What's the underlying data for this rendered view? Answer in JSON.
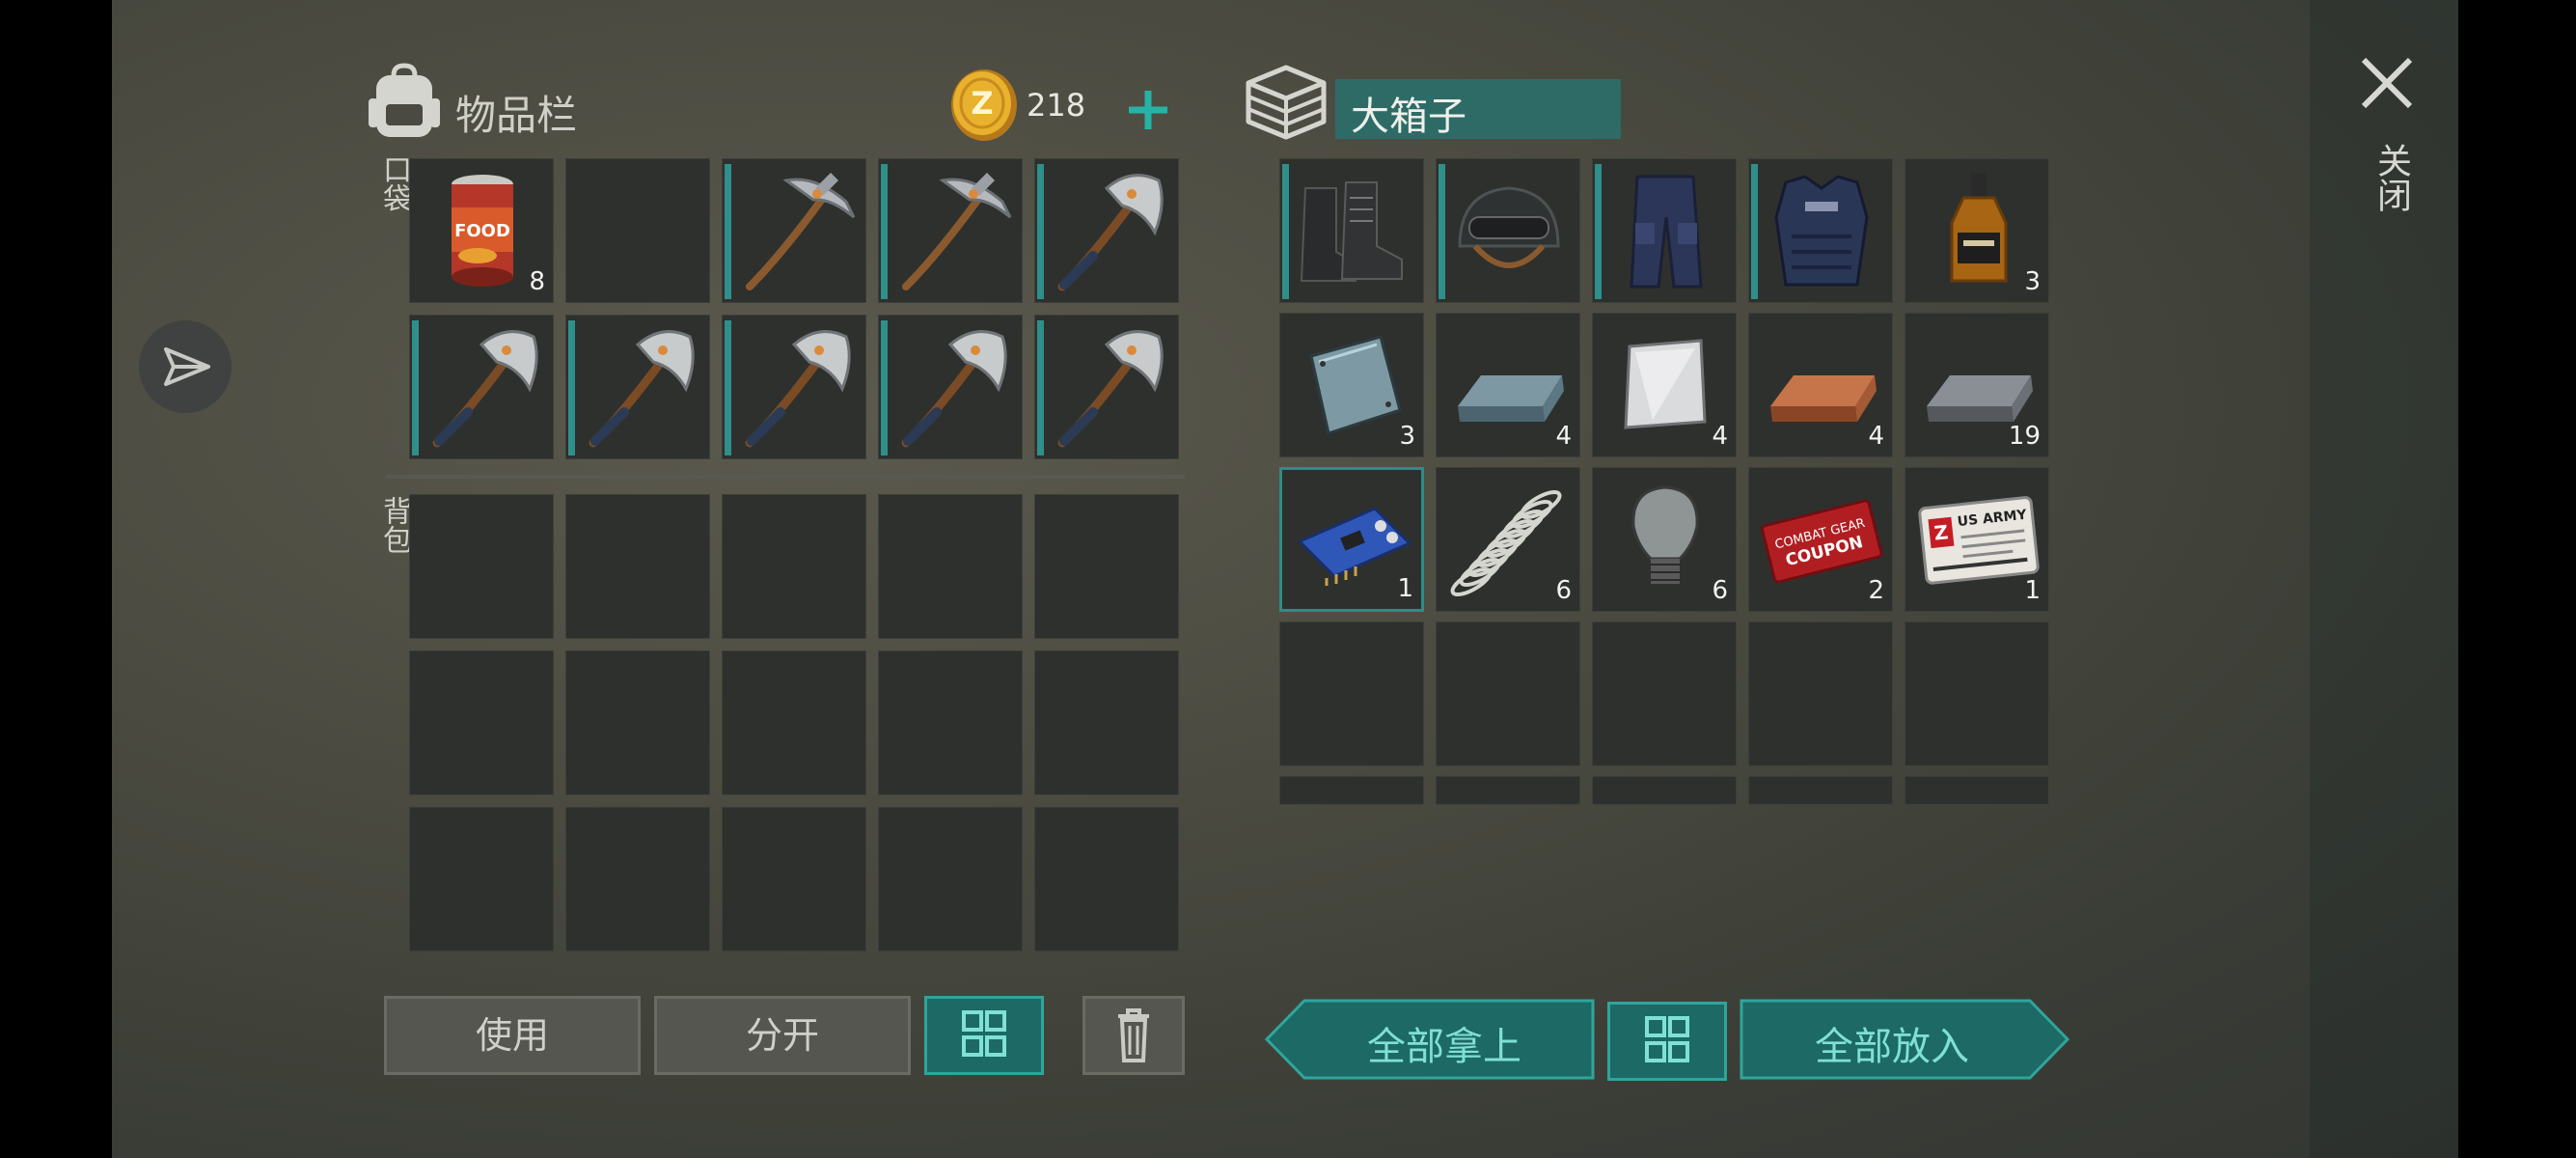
{
  "inventory": {
    "title": "物品栏",
    "coins": "218",
    "pocket_label": "口袋",
    "backpack_label": "背包",
    "pocket_slots": [
      {
        "item": "food-can",
        "count": "8",
        "bar": 0
      },
      {
        "item": "empty",
        "count": "",
        "bar": 0
      },
      {
        "item": "pickaxe",
        "count": "",
        "bar": 1
      },
      {
        "item": "pickaxe",
        "count": "",
        "bar": 1
      },
      {
        "item": "hatchet",
        "count": "",
        "bar": 1
      },
      {
        "item": "hatchet",
        "count": "",
        "bar": 1
      },
      {
        "item": "hatchet",
        "count": "",
        "bar": 1
      },
      {
        "item": "hatchet",
        "count": "",
        "bar": 1
      },
      {
        "item": "hatchet",
        "count": "",
        "bar": 1
      },
      {
        "item": "hatchet",
        "count": "",
        "bar": 1
      }
    ]
  },
  "container": {
    "title": "大箱子",
    "slots": [
      {
        "item": "boots",
        "count": "",
        "bar": 1
      },
      {
        "item": "helmet",
        "count": "",
        "bar": 1
      },
      {
        "item": "pants",
        "count": "",
        "bar": 1
      },
      {
        "item": "vest",
        "count": "",
        "bar": 1
      },
      {
        "item": "whiskey",
        "count": "3",
        "bar": 0
      },
      {
        "item": "metal-plate",
        "count": "3",
        "bar": 0
      },
      {
        "item": "steel-ingot",
        "count": "4",
        "bar": 0
      },
      {
        "item": "aluminum-sheet",
        "count": "4",
        "bar": 0
      },
      {
        "item": "copper-ingot",
        "count": "4",
        "bar": 0
      },
      {
        "item": "iron-ingot",
        "count": "19",
        "bar": 0
      },
      {
        "item": "circuit-board",
        "count": "1",
        "bar": 0,
        "selected": true
      },
      {
        "item": "spring",
        "count": "6",
        "bar": 0
      },
      {
        "item": "light-bulb",
        "count": "6",
        "bar": 0
      },
      {
        "item": "coupon",
        "count": "2",
        "bar": 0
      },
      {
        "item": "id-card",
        "count": "1",
        "bar": 0
      }
    ]
  },
  "buttons": {
    "use": "使用",
    "split": "分开",
    "take_all": "全部拿上",
    "put_all": "全部放入",
    "close": "关闭"
  },
  "coupon_text": [
    "COMBAT GEAR",
    "COUPON"
  ],
  "idcard_text": [
    "US ARMY"
  ],
  "food_text": "FOOD",
  "colors": {
    "accent": "#2f8f8a",
    "slot": "#2e302d",
    "coin": "#e0a928"
  }
}
